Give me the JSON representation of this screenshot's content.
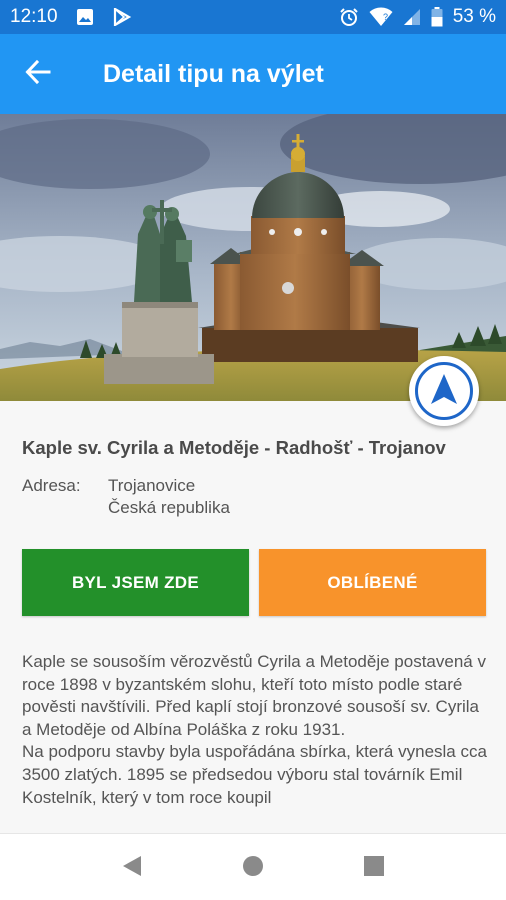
{
  "status_bar": {
    "time": "12:10",
    "battery": "53 %",
    "icons": [
      "image-icon",
      "play-store-icon",
      "alarm-icon",
      "wifi-icon",
      "signal-icon",
      "battery-icon"
    ]
  },
  "app_bar": {
    "title": "Detail tipu na výlet",
    "back_icon": "arrow-left-icon"
  },
  "hero": {
    "description_icon": "navigation-arrow-icon"
  },
  "place": {
    "title": "Kaple sv. Cyrila a Metoděje - Radhošť - Trojanov",
    "address_label": "Adresa:",
    "address_line1": "Trojanovice",
    "address_line2": "Česká republika"
  },
  "buttons": {
    "visited": "BYL JSEM ZDE",
    "favorite": "OBLÍBENÉ"
  },
  "description": {
    "paragraph1": "Kaple se sousoším věrozvěstů Cyrila a Metoděje postavená v roce 1898 v byzantském slohu, kteří toto místo podle staré pověsti navštívili. Před kaplí stojí bronzové sousoší sv. Cyrila a Metoděje od Albína Poláška z roku 1931.",
    "paragraph2": "Na podporu stavby byla uspořádána sbírka, která vynesla cca 3500 zlatých. 1895 se předsedou výboru stal továrník Emil Kostelník, který v tom roce koupil"
  },
  "colors": {
    "status_bar": "#1976d2",
    "app_bar": "#2196f3",
    "visited_button": "#23902a",
    "favorite_button": "#f8932b",
    "nav_icon": "#1e66c8"
  },
  "nav_bar": {
    "icons": [
      "back-triangle-icon",
      "home-circle-icon",
      "recents-square-icon"
    ]
  }
}
